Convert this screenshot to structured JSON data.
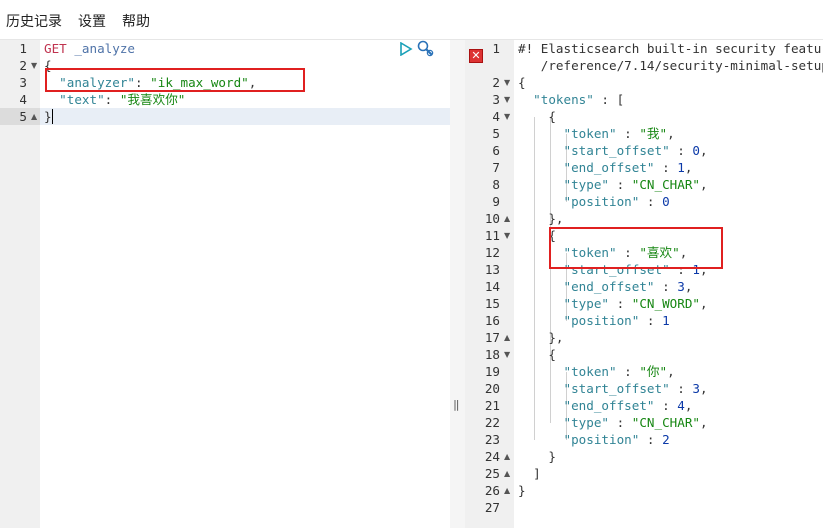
{
  "menu": {
    "history": "历史记录",
    "settings": "设置",
    "help": "帮助"
  },
  "request": {
    "line_numbers": [
      "1",
      "2",
      "3",
      "4",
      "5"
    ],
    "method": "GET",
    "path": "_analyze",
    "open_brace": "{",
    "analyzer_key": "\"analyzer\"",
    "analyzer_value": "\"ik_max_word\"",
    "text_key": "\"text\"",
    "text_value": "\"我喜欢你\"",
    "close_brace": "}"
  },
  "response": {
    "line_numbers": [
      "1",
      "2",
      "3",
      "4",
      "5",
      "6",
      "7",
      "8",
      "9",
      "10",
      "11",
      "12",
      "13",
      "14",
      "15",
      "16",
      "17",
      "18",
      "19",
      "20",
      "21",
      "22",
      "23",
      "24",
      "25",
      "26",
      "27"
    ],
    "warning_line1": "#! Elasticsearch built-in security featu",
    "warning_line2": "/reference/7.14/security-minimal-setup",
    "tokens_key": "\"tokens\"",
    "tokens": [
      {
        "token": "\"我\"",
        "start_offset": "0",
        "end_offset": "1",
        "type": "\"CN_CHAR\"",
        "position": "0"
      },
      {
        "token": "\"喜欢\"",
        "start_offset": "1",
        "end_offset": "3",
        "type": "\"CN_WORD\"",
        "position": "1"
      },
      {
        "token": "\"你\"",
        "start_offset": "3",
        "end_offset": "4",
        "type": "\"CN_CHAR\"",
        "position": "2"
      }
    ],
    "labels": {
      "token": "\"token\"",
      "start_offset": "\"start_offset\"",
      "end_offset": "\"end_offset\"",
      "type": "\"type\"",
      "position": "\"position\""
    }
  },
  "icons": {
    "run": "play-icon",
    "settings": "wrench-icon",
    "error": "error-icon"
  },
  "colors": {
    "highlight_box": "#e02020",
    "gutter": "#f0f0f0",
    "active_line": "#e8eef6"
  }
}
